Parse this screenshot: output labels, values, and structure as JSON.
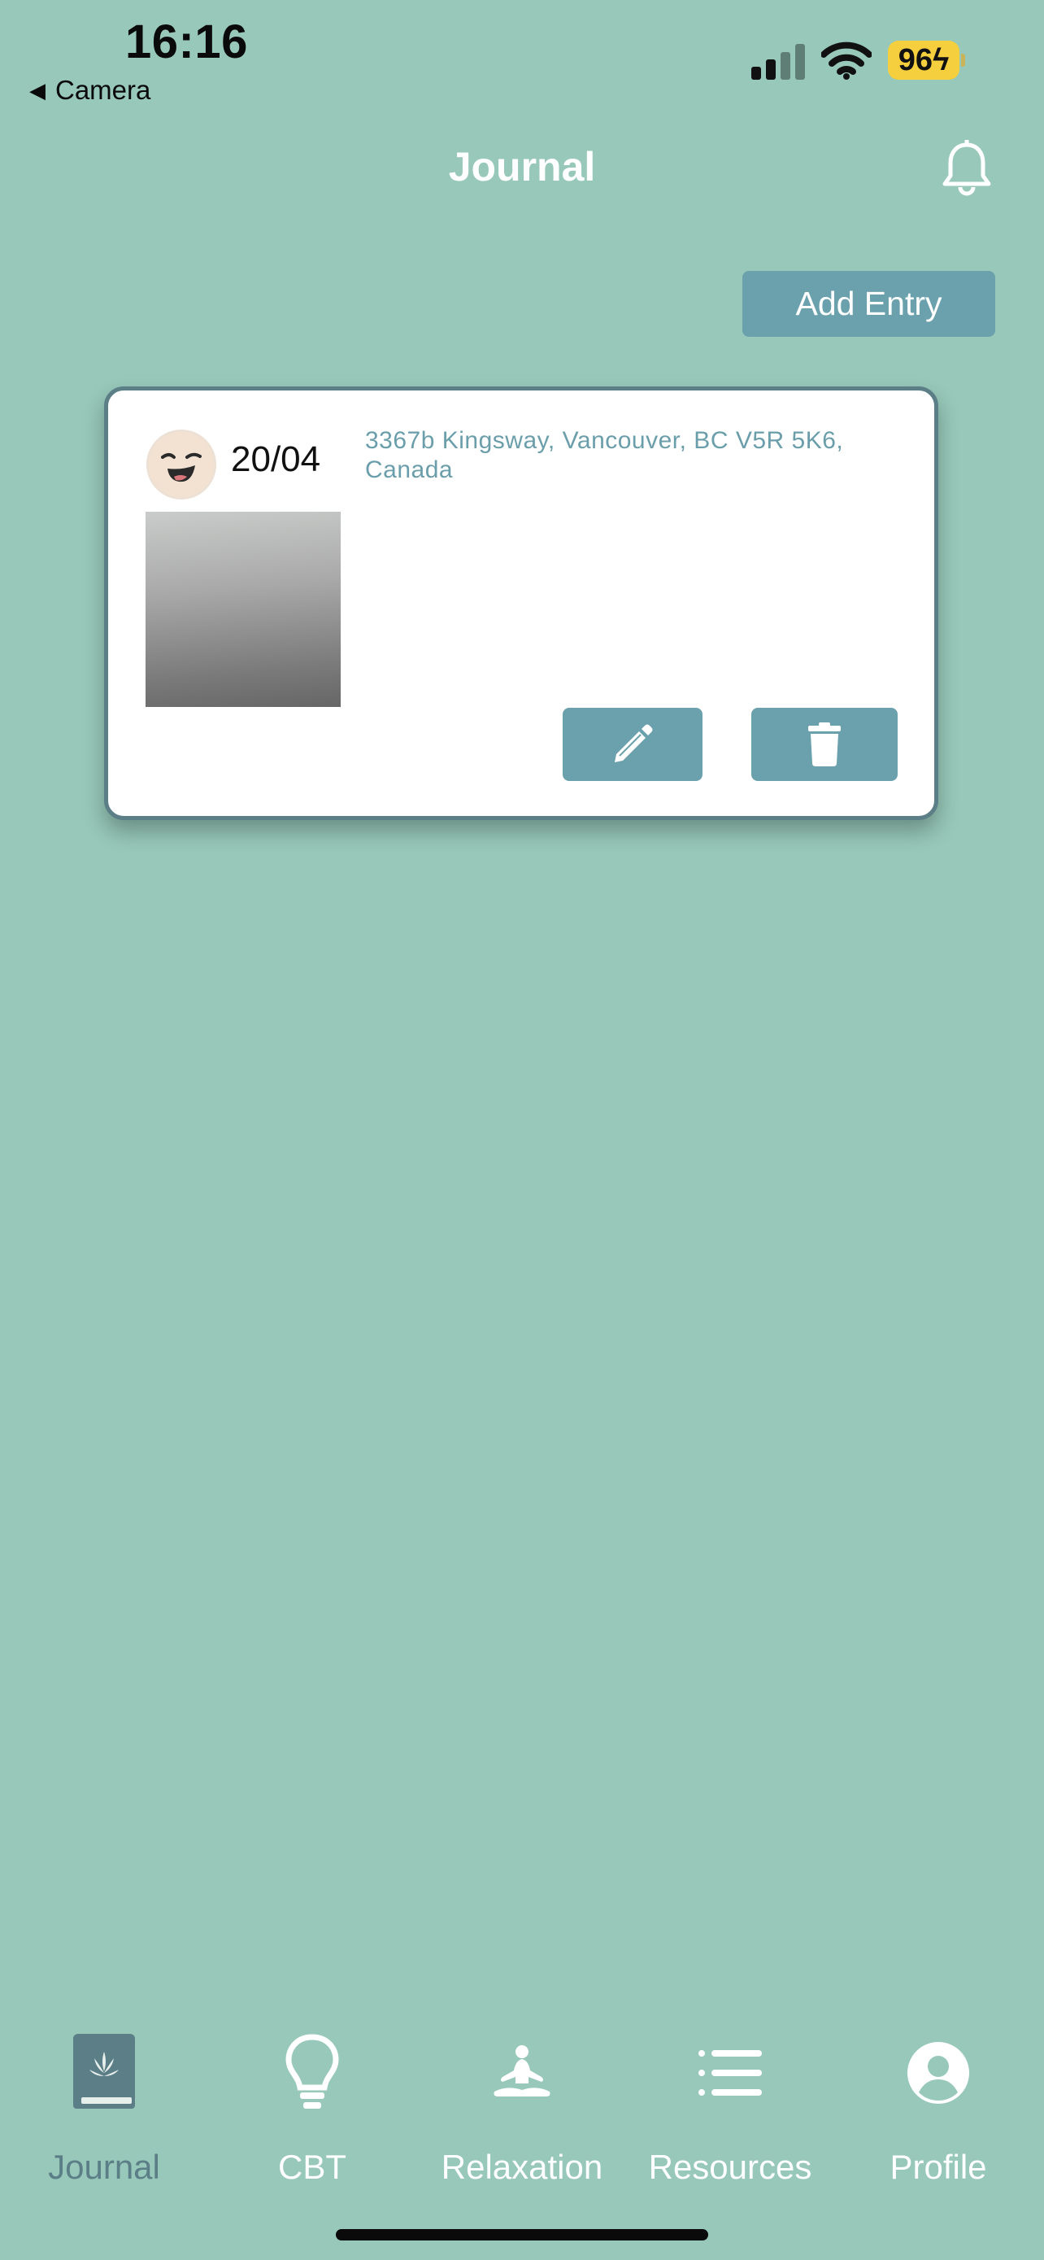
{
  "status_bar": {
    "time": "16:16",
    "back_label": "Camera",
    "battery": "96",
    "battery_color": "#f6cf3f"
  },
  "header": {
    "title": "Journal",
    "bell_icon": "bell-icon"
  },
  "actions": {
    "add_entry_label": "Add Entry"
  },
  "entries": [
    {
      "mood_icon": "smiling-face-avatar",
      "date": "20/04",
      "location": "3367b Kingsway, Vancouver, BC V5R 5K6, Canada",
      "edit_icon": "pencil-icon",
      "delete_icon": "trash-icon"
    }
  ],
  "tabs": [
    {
      "label": "Journal",
      "icon": "journal-book-icon",
      "active": true
    },
    {
      "label": "CBT",
      "icon": "lightbulb-icon",
      "active": false
    },
    {
      "label": "Relaxation",
      "icon": "meditation-icon",
      "active": false
    },
    {
      "label": "Resources",
      "icon": "list-icon",
      "active": false
    },
    {
      "label": "Profile",
      "icon": "user-circle-icon",
      "active": false
    }
  ],
  "colors": {
    "background": "#97c8b9",
    "accent": "#6aa1ad",
    "card_border": "#5b7e87",
    "location_text": "#6b9eab"
  }
}
